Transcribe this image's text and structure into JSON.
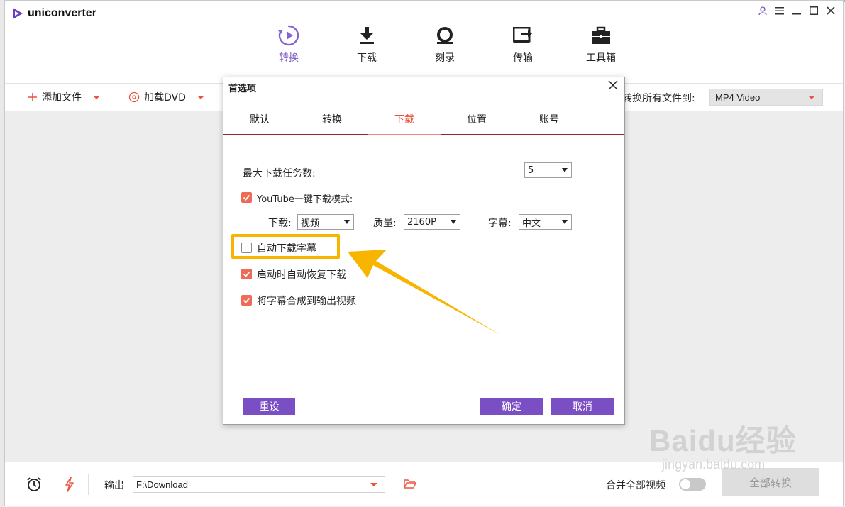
{
  "app": {
    "name": "uniconverter",
    "accent_color": "#7b5bc4",
    "orange_accent": "#e8553f",
    "highlight_color": "#f7b500"
  },
  "nav": [
    {
      "label": "转换",
      "icon": "convert-icon"
    },
    {
      "label": "下载",
      "icon": "download-icon"
    },
    {
      "label": "刻录",
      "icon": "burn-icon"
    },
    {
      "label": "传输",
      "icon": "transfer-icon"
    },
    {
      "label": "工具箱",
      "icon": "toolbox-icon"
    }
  ],
  "toolbar": {
    "add_files": "添加文件",
    "load_dvd": "加载DVD",
    "convert_all_to": "转换所有文件到:",
    "format_value": "MP4 Video"
  },
  "bottom": {
    "output_label": "输出",
    "output_path": "F:\\Download",
    "merge_label": "合并全部视频",
    "convert_all_button": "全部转换"
  },
  "dialog": {
    "title": "首选项",
    "tabs": [
      "默认",
      "转换",
      "下载",
      "位置",
      "账号"
    ],
    "active_tab": "下载",
    "max_tasks_label": "最大下载任务数:",
    "max_tasks_value": "5",
    "youtube_mode_label": "YouTube一键下载模式:",
    "youtube_mode_checked": true,
    "download_label": "下载:",
    "download_value": "视频",
    "quality_label": "质量:",
    "quality_value": "2160P",
    "subtitle_label": "字幕:",
    "subtitle_value": "中文",
    "auto_subtitle_label": "自动下载字幕",
    "auto_subtitle_checked": false,
    "auto_resume_label": "启动时自动恢复下载",
    "auto_resume_checked": true,
    "merge_subtitle_label": "将字幕合成到输出视频",
    "merge_subtitle_checked": true,
    "reset_button": "重设",
    "ok_button": "确定",
    "cancel_button": "取消"
  },
  "watermark": {
    "main": "Baidu经验",
    "sub": "jingyan.baidu.com"
  }
}
